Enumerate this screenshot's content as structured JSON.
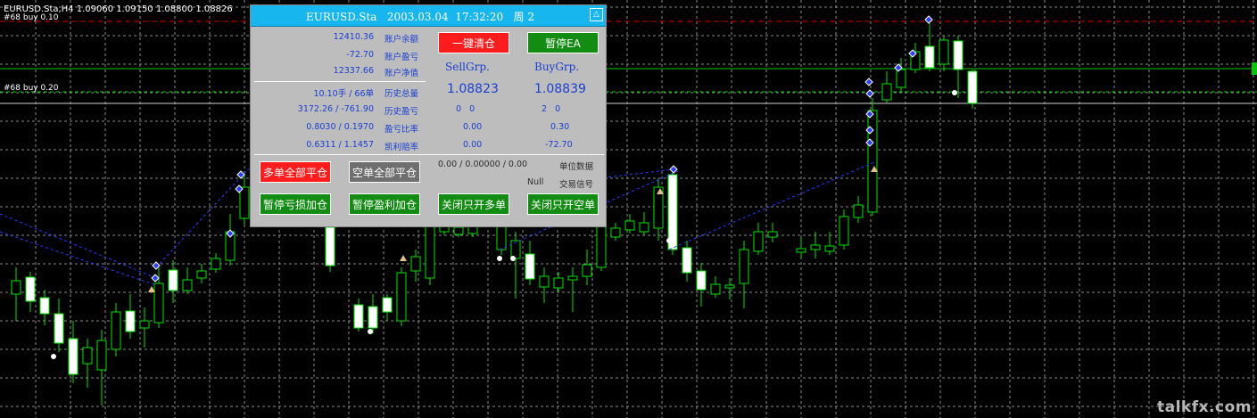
{
  "chart": {
    "symbol_info": "EURUSD.Sta,H4  1.09060 1.09150 1.08800 1.08826",
    "order_labels": [
      "#68 buy 0.10",
      "#68 buy 0.20"
    ],
    "watermark": "talkfx.com",
    "colors": {
      "bull": "#00e400",
      "bear_body": "#ffffff",
      "grid": "#8a8a8a",
      "order_line": "#00c800",
      "stop_line": "#d00000",
      "trend": "#2a3cff"
    }
  },
  "panel": {
    "title": "EURUSD.Sta   2003.03.04  17:32:20   周 2",
    "collapse_icon": "△",
    "account": [
      {
        "value": "12410.36",
        "label": "账户余额"
      },
      {
        "value": "-72.70",
        "label": "账户盈亏"
      },
      {
        "value": "12337.66",
        "label": "账户净值"
      }
    ],
    "history": [
      {
        "value": "10.10手 / 66单",
        "label": "历史总量"
      },
      {
        "value": "3172.26 / -761.90",
        "label": "历史盈亏"
      },
      {
        "value": "0.8030 / 0.1970",
        "label": "盈亏比率"
      },
      {
        "value": "0.6311 / 1.1457",
        "label": "凯利赔率"
      }
    ],
    "buttons": {
      "close_all": "一键清仓",
      "pause_ea": "暂停EA",
      "close_longs": "多单全部平仓",
      "close_shorts": "空单全部平仓",
      "pause_loss_add": "暂停亏损加仓",
      "pause_profit_add": "暂停盈利加仓",
      "long_only_off": "关闭只开多单",
      "short_only_off": "关闭只开空单"
    },
    "sell": {
      "header": "SellGrp.",
      "price": "1.08823",
      "counts": "0   0",
      "ratio": "0.00",
      "pnl": "0.00"
    },
    "buy": {
      "header": "BuyGrp.",
      "price": "1.08839",
      "counts": "2   0",
      "ratio": "0.30",
      "pnl": "-72.70"
    },
    "unit_data": {
      "value": "0.00 / 0.00000 / 0.00",
      "label": "单位数据"
    },
    "signal": {
      "value": "Null",
      "label": "交易信号"
    }
  }
}
